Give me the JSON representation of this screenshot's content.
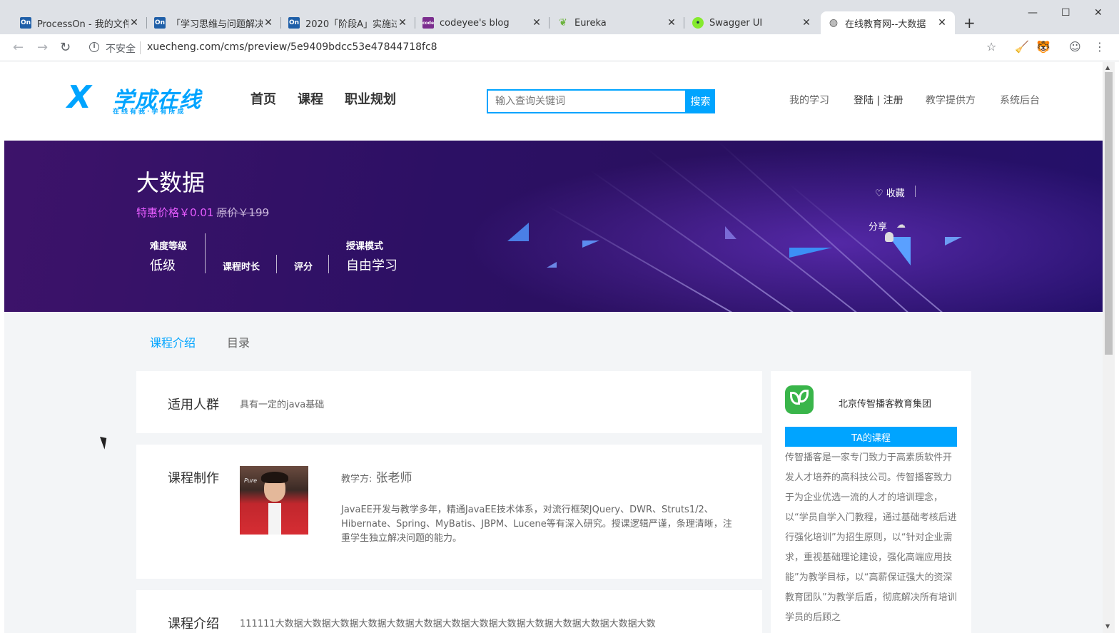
{
  "browser": {
    "tabs": [
      {
        "favicon": "On",
        "title": "ProcessOn - 我的文件"
      },
      {
        "favicon": "On",
        "title": "「学习思维与问题解决"
      },
      {
        "favicon": "On",
        "title": "2020「阶段A」实施过"
      },
      {
        "favicon": "code",
        "title": "codeyee's blog"
      },
      {
        "favicon": "leaf-icon",
        "title": "Eureka"
      },
      {
        "favicon": "swagger-icon",
        "title": "Swagger UI"
      },
      {
        "favicon": "globe-icon",
        "title": "在线教育网--大数据"
      }
    ],
    "active_tab": 6,
    "security_label": "不安全",
    "url": "xuecheng.com/cms/preview/5e9409bdcc53e47844718fc8"
  },
  "site": {
    "logo_mark": "X",
    "logo_text": "学成在线",
    "logo_sub": "在线有我·学有所成",
    "nav": [
      "首页",
      "课程",
      "职业规划"
    ],
    "search_placeholder": "输入查询关键词",
    "search_button": "搜索",
    "links": {
      "my_learning": "我的学习",
      "login": "登陆 | 注册",
      "provider": "教学提供方",
      "admin": "系统后台"
    }
  },
  "course": {
    "title": "大数据",
    "price_label": "特惠价格￥0.01",
    "orig_price": "原价￥199",
    "attrs": {
      "difficulty_label": "难度等级",
      "difficulty_value": "低级",
      "duration_label": "课程时长",
      "rating_label": "评分",
      "mode_label": "授课模式",
      "mode_value": "自由学习"
    },
    "favorite": "收藏",
    "share": "分享"
  },
  "content_tabs": [
    "课程介绍",
    "目录"
  ],
  "audience": {
    "title": "适用人群",
    "text": "具有一定的java基础"
  },
  "production": {
    "title": "课程制作",
    "teacher_label": "教学方:",
    "teacher_name": "张老师",
    "photo_caption": "Pure",
    "bio": "JavaEE开发与教学多年，精通JavaEE技术体系，对流行框架JQuery、DWR、Struts1/2、Hibernate、Spring、MyBatis、JBPM、Lucene等有深入研究。授课逻辑严谨，条理清晰，注重学生独立解决问题的能力。"
  },
  "intro": {
    "title": "课程介绍",
    "text": "111111大数据大数据大数据大数据大数据大数据大数据大数据大数据大数据大数据大数据大数据大数"
  },
  "org": {
    "name": "北京传智播客教育集团",
    "button": "TA的课程",
    "description": "传智播客是一家专门致力于高素质软件开发人才培养的高科技公司。传智播客致力于为企业优选一流的人才的培训理念，以“学员自学入门教程，通过基础考核后进行强化培训”为招生原则，以“针对企业需求，重视基础理论建设，强化高端应用技能”为教学目标，以“高薪保证强大的资深教育团队”为教学后盾，彻底解决所有培训学员的后顾之"
  },
  "colors": {
    "accent": "#00a4ff",
    "price": "#e65cff",
    "banner": "#2c1064"
  }
}
